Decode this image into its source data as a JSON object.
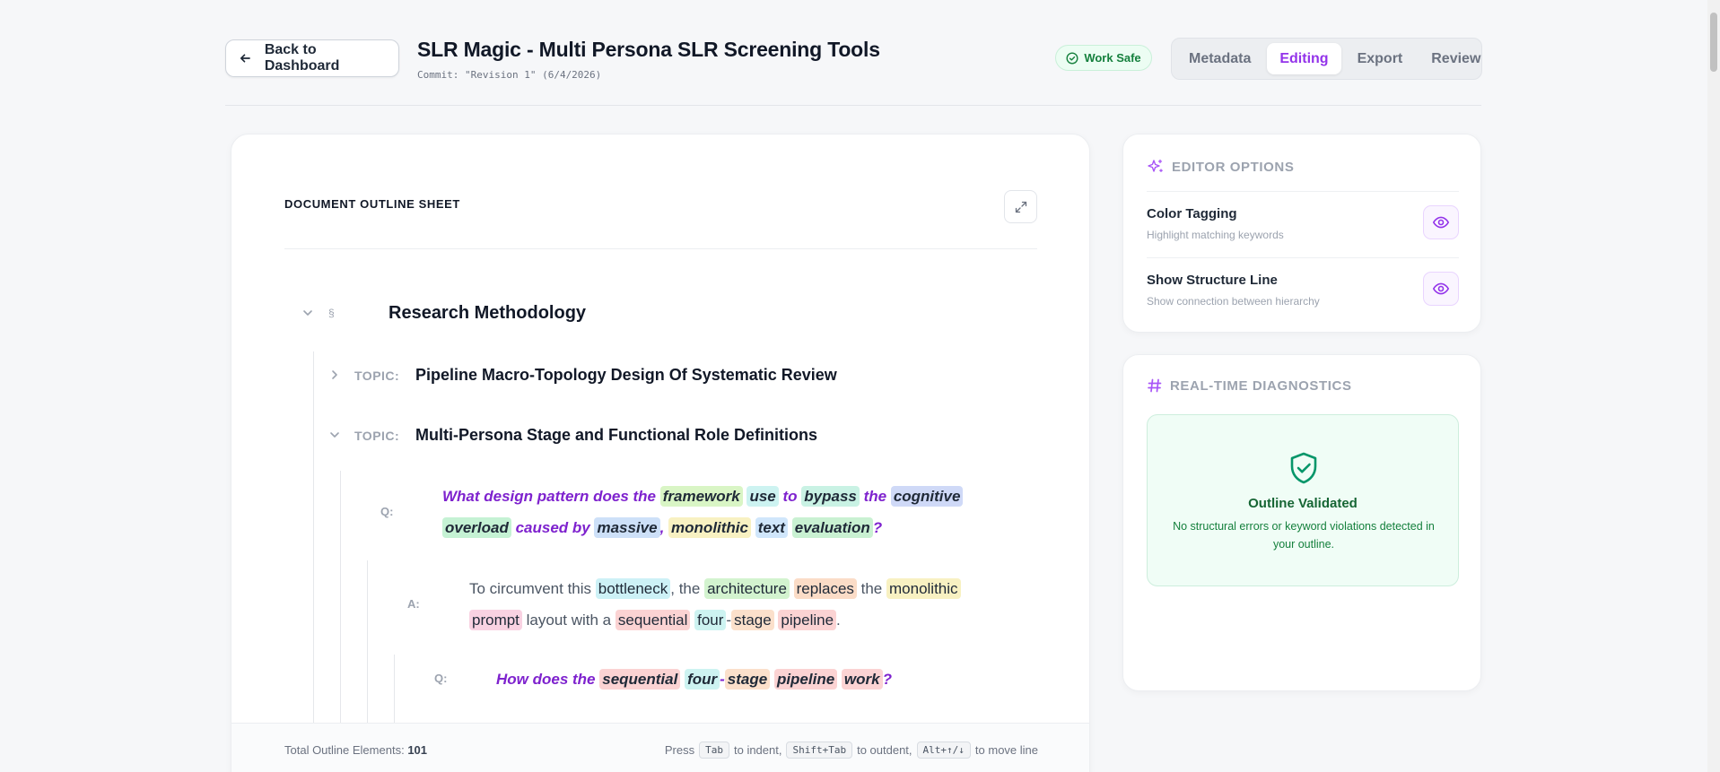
{
  "header": {
    "back_label": "Back to Dashboard",
    "title": "SLR Magic - Multi Persona SLR Screening Tools",
    "commit": "Commit: \"Revision 1\" (6/4/2026)",
    "status_badge": "Work Safe",
    "tabs": [
      {
        "label": "Metadata",
        "active": false
      },
      {
        "label": "Editing",
        "active": true
      },
      {
        "label": "Export",
        "active": false
      },
      {
        "label": "Review",
        "active": false
      }
    ]
  },
  "outline": {
    "heading": "DOCUMENT OUTLINE SHEET",
    "section_marker": "§",
    "section_title": "Research Methodology",
    "topic_label": "TOPIC:",
    "topics": [
      {
        "text": "Pipeline Macro-Topology Design Of Systematic Review"
      },
      {
        "text": "Multi-Persona Stage and Functional Role Definitions"
      }
    ],
    "q_label": "Q:",
    "a_label": "A:",
    "q1_line1": [
      {
        "t": "What design pattern does the "
      },
      {
        "t": "framework",
        "c": "#d9f5c5"
      },
      {
        "t": " "
      },
      {
        "t": "use",
        "c": "#cdf3f1"
      },
      {
        "t": " to "
      },
      {
        "t": "bypass",
        "c": "#c9f2e4"
      },
      {
        "t": " the "
      },
      {
        "t": "cognitive",
        "c": "#cfd9f7"
      }
    ],
    "q1_line2": [
      {
        "t": "overload",
        "c": "#c5f2d4"
      },
      {
        "t": " caused by "
      },
      {
        "t": "massive",
        "c": "#cde0f8"
      },
      {
        "t": ", "
      },
      {
        "t": "monolithic",
        "c": "#f8f1c2"
      },
      {
        "t": " "
      },
      {
        "t": "text",
        "c": "#d0e6fb"
      },
      {
        "t": " "
      },
      {
        "t": "evaluation",
        "c": "#c9f1d2"
      },
      {
        "t": "?"
      }
    ],
    "a1_line1": [
      {
        "t": "To circumvent this "
      },
      {
        "t": "bottleneck",
        "c": "#cdf1f6"
      },
      {
        "t": ", the "
      },
      {
        "t": "architecture",
        "c": "#d3f3cf"
      },
      {
        "t": " "
      },
      {
        "t": "replaces",
        "c": "#fbdcc7"
      },
      {
        "t": " the "
      },
      {
        "t": "monolithic",
        "c": "#f8f1c2"
      }
    ],
    "a1_line2": [
      {
        "t": "prompt",
        "c": "#f9d2e2"
      },
      {
        "t": " layout with a "
      },
      {
        "t": "sequential",
        "c": "#fbd3d3"
      },
      {
        "t": " "
      },
      {
        "t": "four",
        "c": "#cdf3f1"
      },
      {
        "t": "-"
      },
      {
        "t": "stage",
        "c": "#fbe0cb"
      },
      {
        "t": " "
      },
      {
        "t": "pipeline",
        "c": "#fbd3d3"
      },
      {
        "t": "."
      }
    ],
    "q2_line1": [
      {
        "t": "How does the "
      },
      {
        "t": "sequential",
        "c": "#fbd3d3"
      },
      {
        "t": " "
      },
      {
        "t": "four",
        "c": "#cdf3f1"
      },
      {
        "t": "-"
      },
      {
        "t": "stage",
        "c": "#fbe0cb"
      },
      {
        "t": " "
      },
      {
        "t": "pipeline",
        "c": "#fbd3d3"
      },
      {
        "t": " "
      },
      {
        "t": "work",
        "c": "#fbd3d3"
      },
      {
        "t": "?"
      }
    ],
    "footer_count_label": "Total Outline Elements:",
    "footer_count": "101",
    "footer_hint": {
      "press": "Press",
      "key_indent": "Tab",
      "to_indent": "to indent,",
      "key_outdent": "Shift+Tab",
      "to_outdent": "to outdent,",
      "key_move": "Alt+↑/↓",
      "to_move": "to move line"
    }
  },
  "editor_options": {
    "heading": "EDITOR OPTIONS",
    "options": [
      {
        "title": "Color Tagging",
        "subtitle": "Highlight matching keywords"
      },
      {
        "title": "Show Structure Line",
        "subtitle": "Show connection between hierarchy"
      }
    ]
  },
  "diagnostics": {
    "heading": "REAL-TIME DIAGNOSTICS",
    "status_title": "Outline Validated",
    "status_text": "No structural errors or keyword violations detected in your outline."
  },
  "colors": {
    "accent": "#9333ea",
    "success": "#15803d",
    "muted": "#9ca3af"
  }
}
